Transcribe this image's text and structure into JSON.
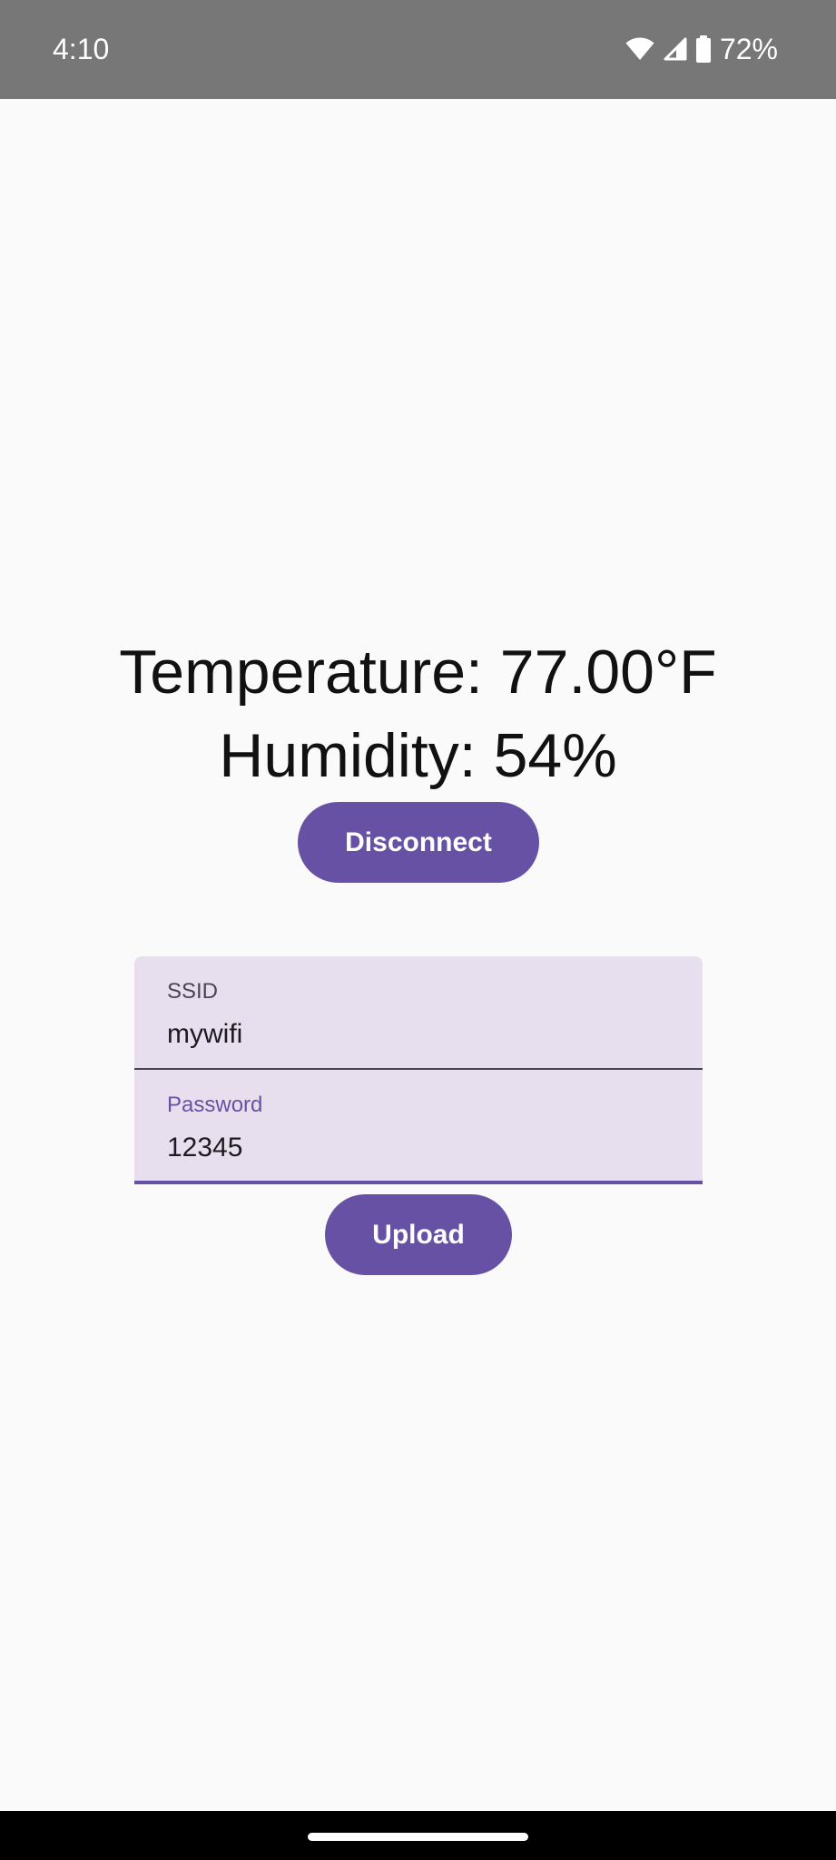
{
  "status_bar": {
    "time": "4:10",
    "battery_percent": "72%",
    "icons": [
      "wifi-icon",
      "signal-icon",
      "battery-icon"
    ]
  },
  "readings": {
    "temperature": "Temperature: 77.00°F",
    "humidity": "Humidity: 54%"
  },
  "buttons": {
    "disconnect_label": "Disconnect",
    "upload_label": "Upload"
  },
  "fields": {
    "ssid": {
      "label": "SSID",
      "value": "mywifi"
    },
    "password": {
      "label": "Password",
      "value": "12345"
    }
  },
  "colors": {
    "primary": "#6751a5",
    "field_background": "#e7dfee",
    "status_bar": "#777777",
    "background": "#fafafa"
  }
}
